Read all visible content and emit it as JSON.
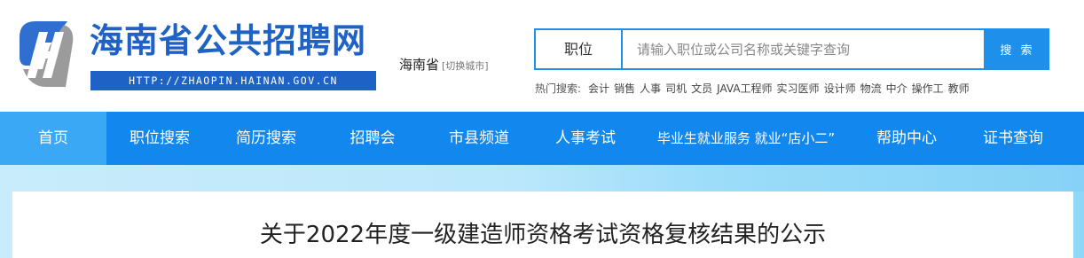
{
  "header": {
    "site_name": "海南省公共招聘网",
    "site_url": "HTTP://ZHAOPIN.HAINAN.GOV.CN",
    "city": "海南省",
    "switch_city": "[切换城市]"
  },
  "search": {
    "type_label": "职位",
    "placeholder": "请输入职位或公司名称或关键字查询",
    "value": "",
    "button_label": "搜 索"
  },
  "hot_search": {
    "label": "热门搜索:",
    "terms": [
      "会计",
      "销售",
      "人事",
      "司机",
      "文员",
      "JAVA工程师",
      "实习医师",
      "设计师",
      "物流",
      "中介",
      "操作工",
      "教师"
    ]
  },
  "nav": {
    "items": [
      {
        "label": "首页"
      },
      {
        "label": "职位搜索"
      },
      {
        "label": "简历搜索"
      },
      {
        "label": "招聘会"
      },
      {
        "label": "市县频道"
      },
      {
        "label": "人事考试"
      },
      {
        "label": "毕业生就业服务 就业“店小二”"
      },
      {
        "label": "帮助中心"
      },
      {
        "label": "证书查询"
      }
    ]
  },
  "article": {
    "title": "关于2022年度一级建造师资格考试资格复核结果的公示"
  },
  "colors": {
    "brand_blue": "#1f62c6",
    "nav_blue": "#1287ee",
    "nav_active": "#3aa8f5",
    "search_border": "#1e8fea"
  }
}
